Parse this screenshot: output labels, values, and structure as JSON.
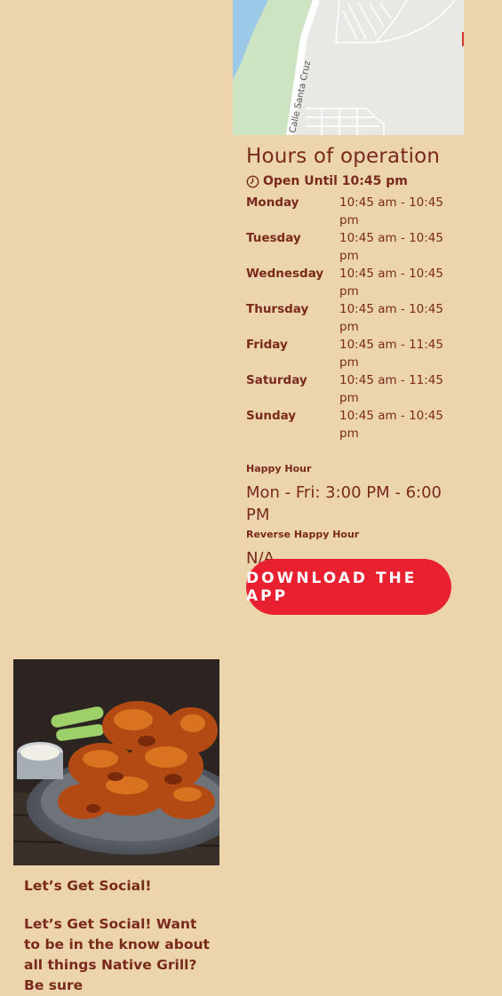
{
  "map": {
    "street_label": "Calle Santa Cruz"
  },
  "hours": {
    "title": "Hours of operation",
    "open_until": "Open Until 10:45 pm",
    "rows": [
      {
        "day": "Monday",
        "time": "10:45 am - 10:45 pm"
      },
      {
        "day": "Tuesday",
        "time": "10:45 am - 10:45 pm"
      },
      {
        "day": "Wednesday",
        "time": "10:45 am - 10:45 pm"
      },
      {
        "day": "Thursday",
        "time": "10:45 am - 10:45 pm"
      },
      {
        "day": "Friday",
        "time": "10:45 am - 11:45 pm"
      },
      {
        "day": "Saturday",
        "time": "10:45 am - 11:45 pm"
      },
      {
        "day": "Sunday",
        "time": "10:45 am - 10:45 pm"
      }
    ],
    "happy_hour_label": "Happy Hour",
    "happy_hour_value": "Mon - Fri: 3:00 PM - 6:00 PM",
    "reverse_happy_hour_label": "Reverse Happy Hour",
    "reverse_happy_hour_value": "N/A"
  },
  "cta": {
    "download_label": "DOWNLOAD THE APP",
    "color": "#e92030"
  },
  "social": {
    "title": "Let’s Get Social!",
    "body": "Let’s Get Social! Want to be in the know about all things Native Grill? Be sure"
  },
  "icons": {
    "clock": "clock-icon"
  },
  "colors": {
    "background": "#ecd5ad",
    "text": "#7a2a1c"
  }
}
